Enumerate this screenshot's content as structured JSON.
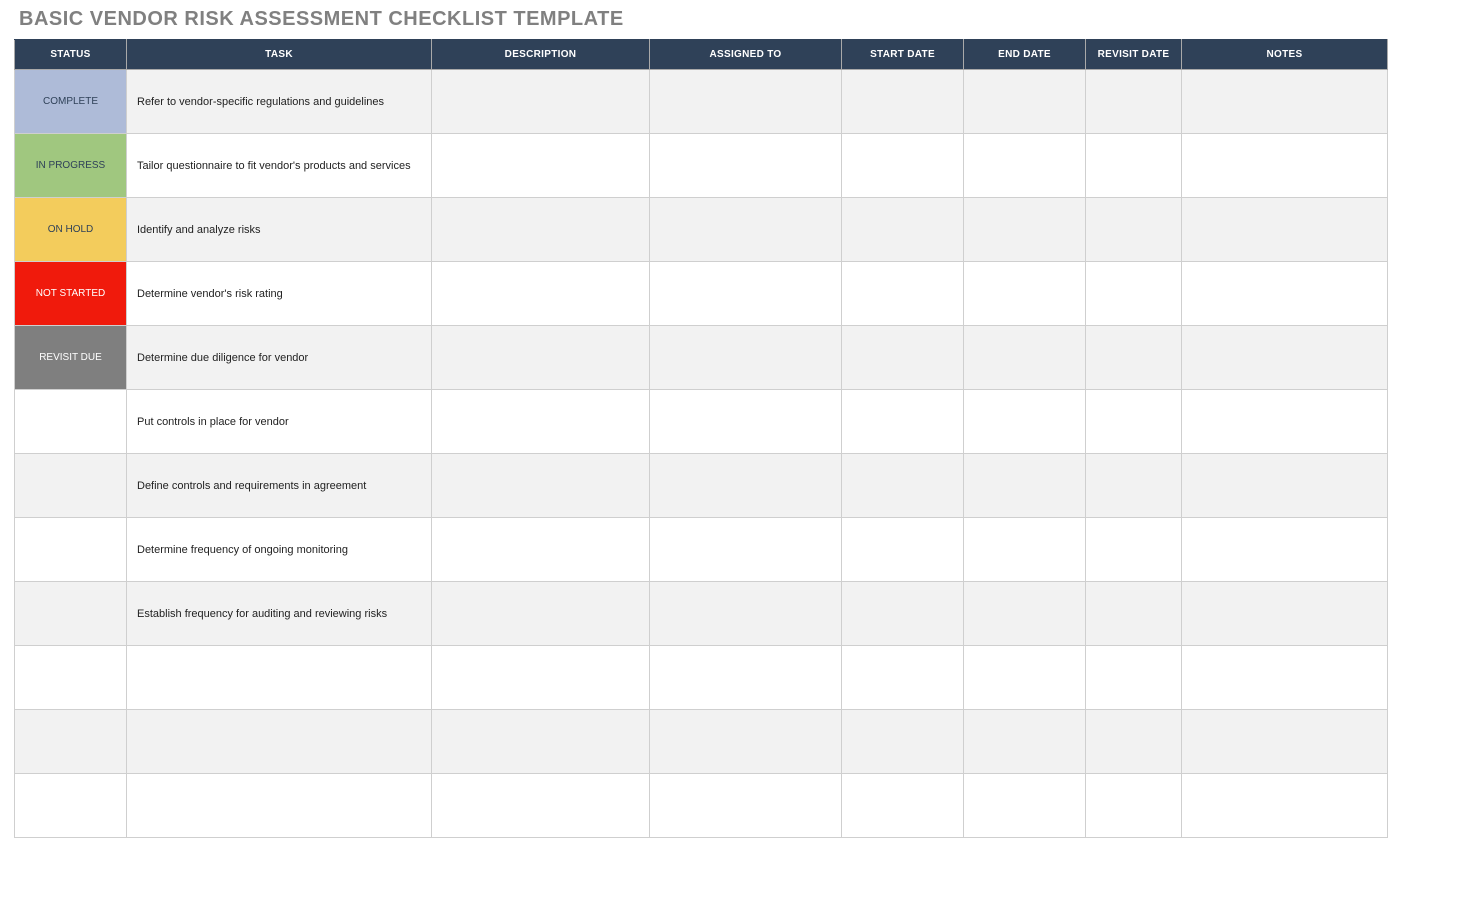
{
  "title": "BASIC VENDOR RISK ASSESSMENT CHECKLIST TEMPLATE",
  "headers": {
    "status": "STATUS",
    "task": "TASK",
    "description": "DESCRIPTION",
    "assigned_to": "ASSIGNED TO",
    "start_date": "START DATE",
    "end_date": "END DATE",
    "revisit_date": "REVISIT DATE",
    "notes": "NOTES"
  },
  "status_colors": {
    "COMPLETE": "#aebbd8",
    "IN PROGRESS": "#a0c77f",
    "ON HOLD": "#f3cc5c",
    "NOT STARTED": "#f01a0c",
    "REVISIT DUE": "#7f7f7f"
  },
  "rows": [
    {
      "status": "COMPLETE",
      "status_class": "status-complete",
      "task": "Refer to vendor-specific regulations and guidelines",
      "description": "",
      "assigned_to": "",
      "start_date": "",
      "end_date": "",
      "revisit_date": "",
      "notes": ""
    },
    {
      "status": "IN PROGRESS",
      "status_class": "status-inprogress",
      "task": "Tailor questionnaire to fit vendor's products and services",
      "description": "",
      "assigned_to": "",
      "start_date": "",
      "end_date": "",
      "revisit_date": "",
      "notes": ""
    },
    {
      "status": "ON HOLD",
      "status_class": "status-onhold",
      "task": "Identify and analyze risks",
      "description": "",
      "assigned_to": "",
      "start_date": "",
      "end_date": "",
      "revisit_date": "",
      "notes": ""
    },
    {
      "status": "NOT STARTED",
      "status_class": "status-notstarted",
      "task": "Determine vendor's risk rating",
      "description": "",
      "assigned_to": "",
      "start_date": "",
      "end_date": "",
      "revisit_date": "",
      "notes": ""
    },
    {
      "status": "REVISIT DUE",
      "status_class": "status-revisitdue",
      "task": "Determine due diligence for vendor",
      "description": "",
      "assigned_to": "",
      "start_date": "",
      "end_date": "",
      "revisit_date": "",
      "notes": ""
    },
    {
      "status": "",
      "status_class": "status-empty",
      "task": "Put controls in place for vendor",
      "description": "",
      "assigned_to": "",
      "start_date": "",
      "end_date": "",
      "revisit_date": "",
      "notes": ""
    },
    {
      "status": "",
      "status_class": "status-empty",
      "task": "Define controls and requirements in agreement",
      "description": "",
      "assigned_to": "",
      "start_date": "",
      "end_date": "",
      "revisit_date": "",
      "notes": ""
    },
    {
      "status": "",
      "status_class": "status-empty",
      "task": "Determine frequency of ongoing monitoring",
      "description": "",
      "assigned_to": "",
      "start_date": "",
      "end_date": "",
      "revisit_date": "",
      "notes": ""
    },
    {
      "status": "",
      "status_class": "status-empty",
      "task": "Establish frequency for auditing and reviewing risks",
      "description": "",
      "assigned_to": "",
      "start_date": "",
      "end_date": "",
      "revisit_date": "",
      "notes": ""
    },
    {
      "status": "",
      "status_class": "status-empty",
      "task": "",
      "description": "",
      "assigned_to": "",
      "start_date": "",
      "end_date": "",
      "revisit_date": "",
      "notes": ""
    },
    {
      "status": "",
      "status_class": "status-empty",
      "task": "",
      "description": "",
      "assigned_to": "",
      "start_date": "",
      "end_date": "",
      "revisit_date": "",
      "notes": ""
    },
    {
      "status": "",
      "status_class": "status-empty",
      "task": "",
      "description": "",
      "assigned_to": "",
      "start_date": "",
      "end_date": "",
      "revisit_date": "",
      "notes": ""
    }
  ]
}
